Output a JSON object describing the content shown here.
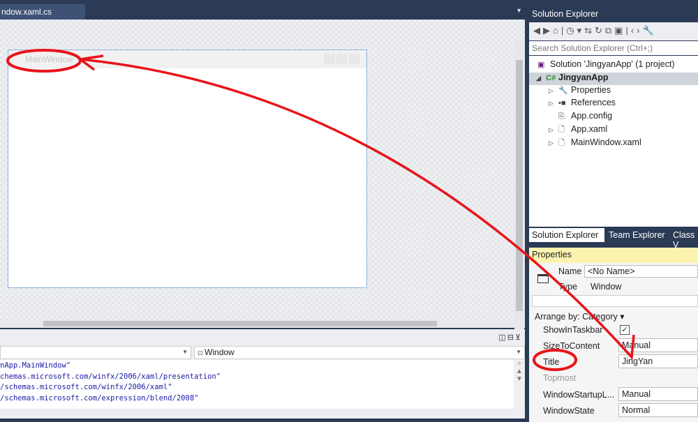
{
  "editor": {
    "tab_label": "ndow.xaml.cs",
    "designer_window_title": "MainWindow",
    "element_combo": "Window",
    "code_lines": [
      "nApp.MainWindow\"",
      "chemas.microsoft.com/winfx/2006/xaml/presentation\"",
      "/schemas.microsoft.com/winfx/2006/xaml\"",
      "/schemas.microsoft.com/expression/blend/2008\""
    ]
  },
  "solution_explorer": {
    "title": "Solution Explorer",
    "search_placeholder": "Search Solution Explorer (Ctrl+;)",
    "tree": {
      "solution": "Solution 'JingyanApp' (1 project)",
      "project": "JingyanApp",
      "items": [
        "Properties",
        "References",
        "App.config",
        "App.xaml",
        "MainWindow.xaml"
      ]
    },
    "tabs": [
      "Solution Explorer",
      "Team Explorer",
      "Class V"
    ]
  },
  "properties": {
    "title": "Properties",
    "name_label": "Name",
    "name_value": "<No Name>",
    "type_label": "Type",
    "type_value": "Window",
    "arrange_by": "Arrange by: Category",
    "rows": [
      {
        "label": "ShowInTaskbar",
        "value": "✓"
      },
      {
        "label": "SizeToContent",
        "value": "Manual"
      },
      {
        "label": "Title",
        "value": "JingYan"
      },
      {
        "label": "Topmost",
        "value": ""
      },
      {
        "label": "WindowStartupL...",
        "value": "Manual"
      },
      {
        "label": "WindowState",
        "value": "Normal"
      }
    ]
  },
  "colors": {
    "annotation": "#e8141a",
    "frame": "#2b3a55",
    "properties_header": "#fcf3b0"
  }
}
